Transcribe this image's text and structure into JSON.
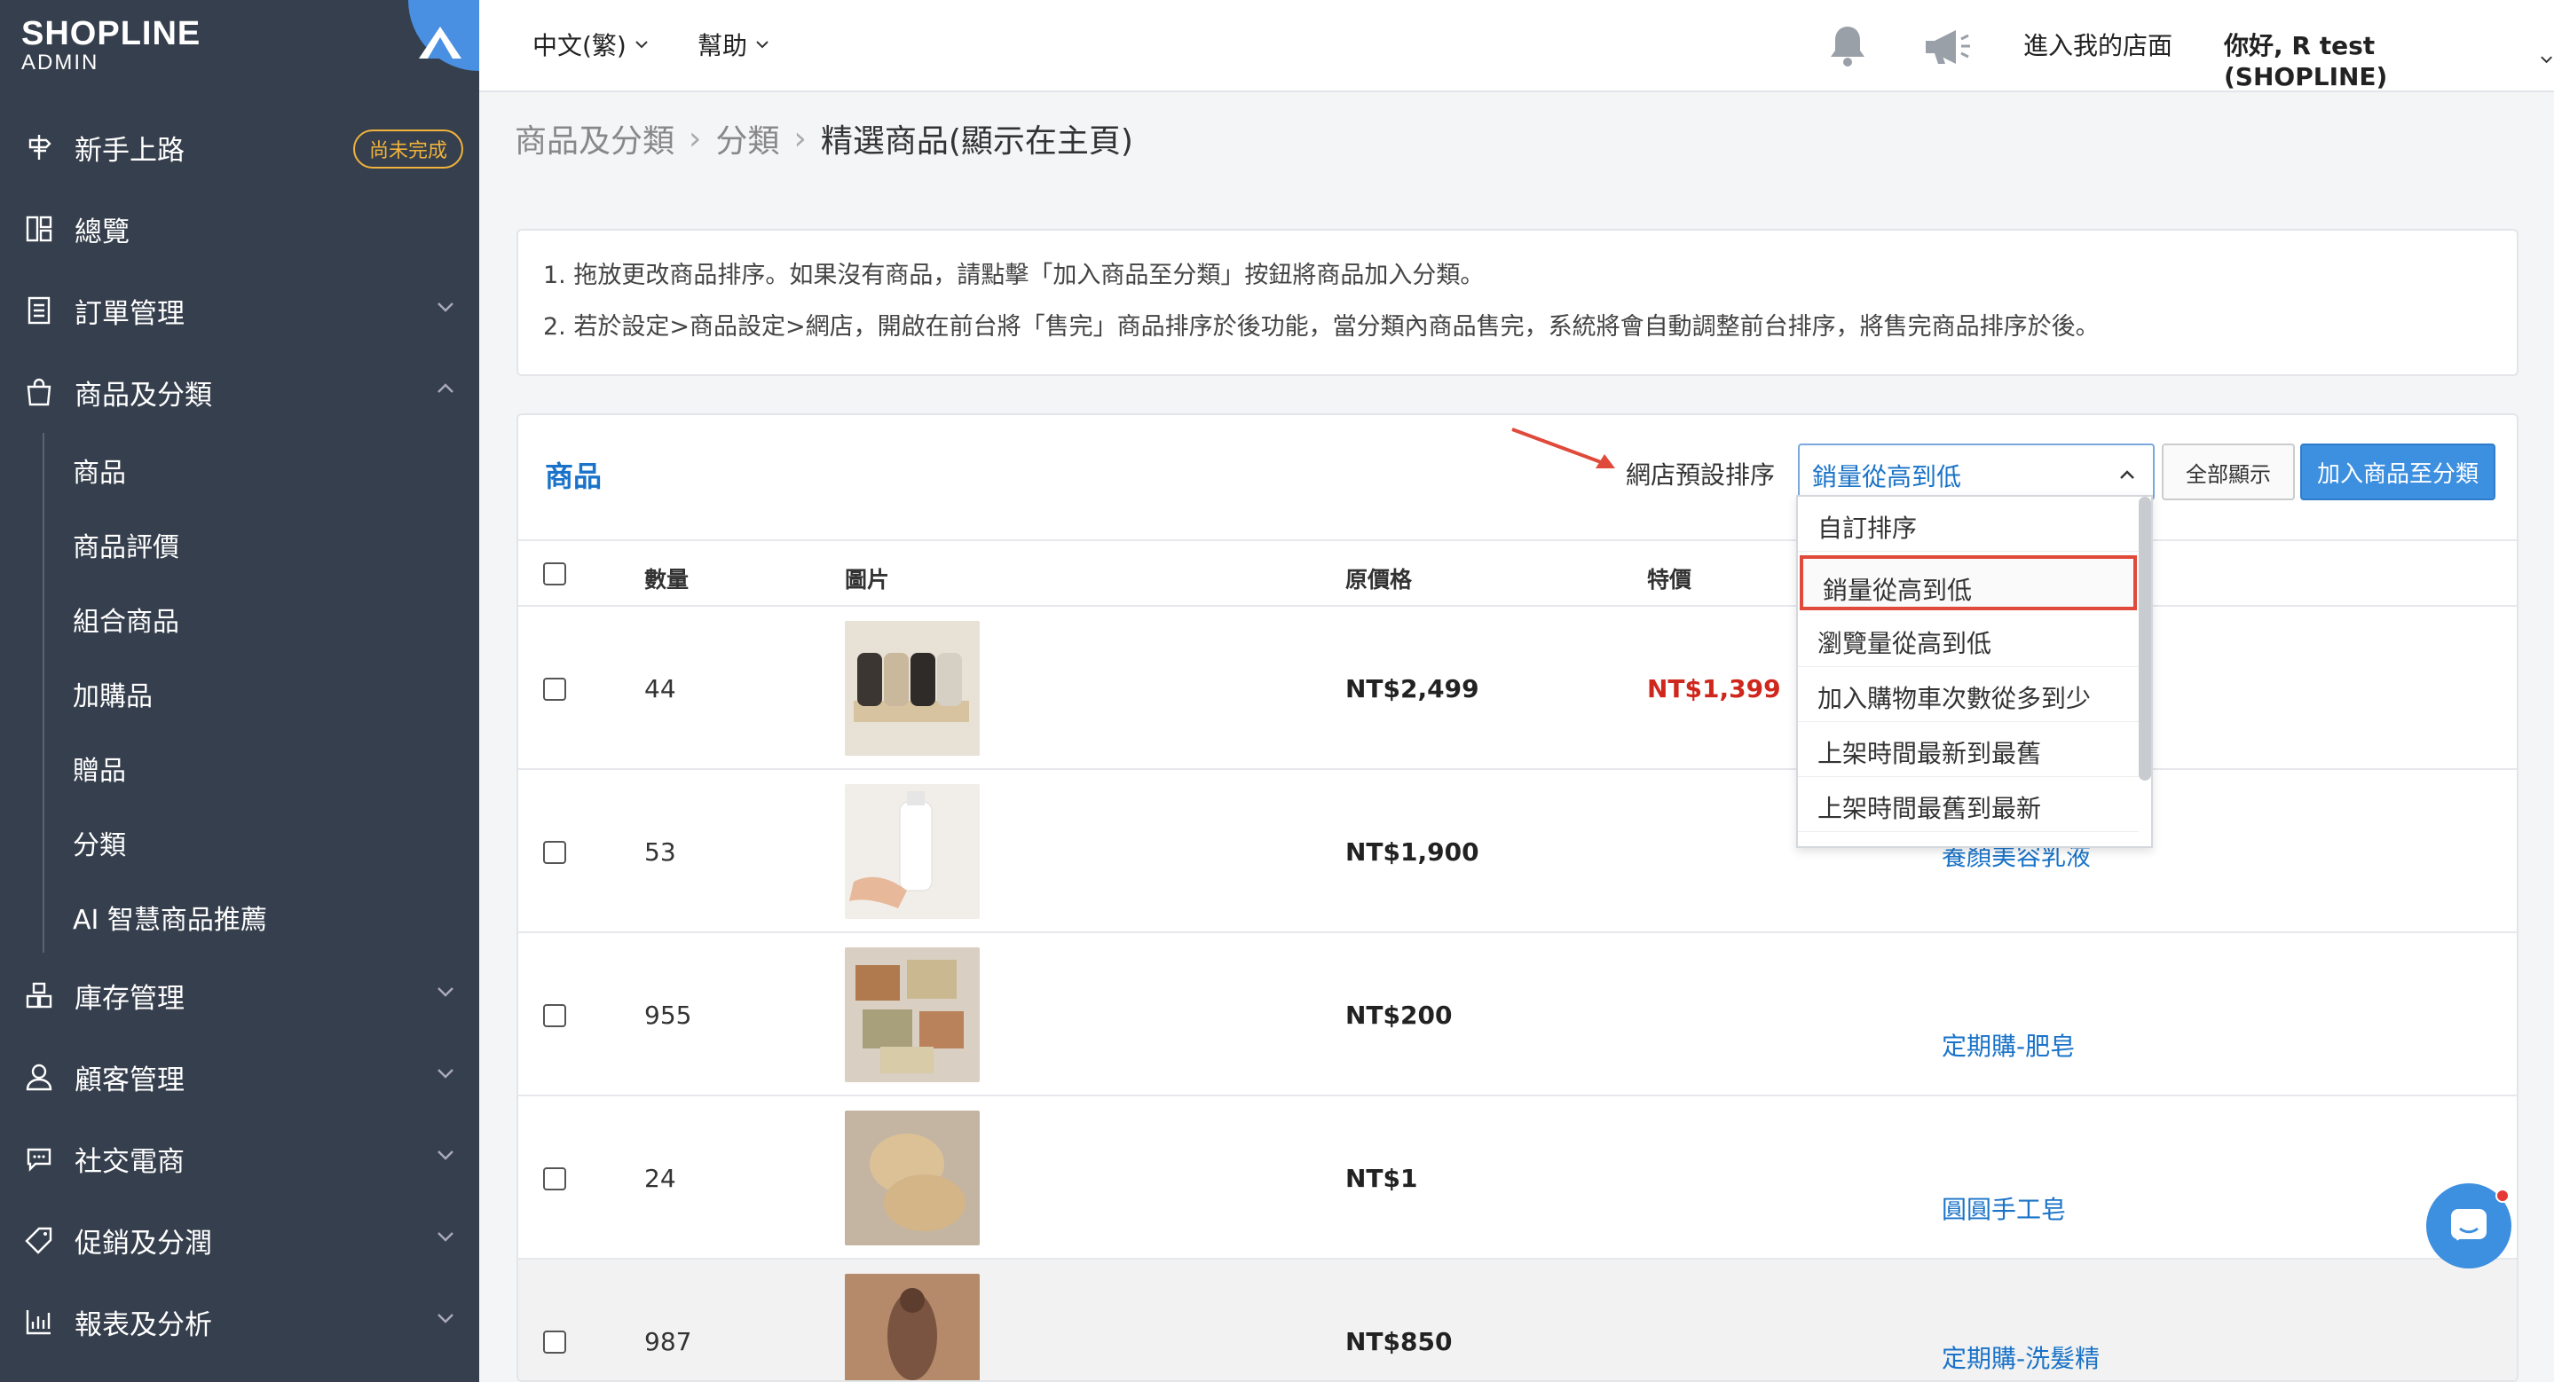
{
  "brand": {
    "name": "SHOPLINE",
    "sub": "ADMIN"
  },
  "sidebar": {
    "items": [
      {
        "label": "新手上路",
        "icon": "signpost-icon",
        "badge": "尚未完成"
      },
      {
        "label": "總覽",
        "icon": "dashboard-icon"
      },
      {
        "label": "訂單管理",
        "icon": "order-list-icon"
      },
      {
        "label": "商品及分類",
        "icon": "shopping-bag-icon"
      },
      {
        "label": "庫存管理",
        "icon": "inventory-icon"
      },
      {
        "label": "顧客管理",
        "icon": "user-icon"
      },
      {
        "label": "社交電商",
        "icon": "chat-bubble-icon"
      },
      {
        "label": "促銷及分潤",
        "icon": "tag-icon"
      },
      {
        "label": "報表及分析",
        "icon": "chart-icon"
      }
    ],
    "submenu": [
      "商品",
      "商品評價",
      "組合商品",
      "加購品",
      "贈品",
      "分類",
      "AI 智慧商品推薦"
    ]
  },
  "topbar": {
    "language": "中文(繁)",
    "help": "幫助",
    "enter_store": "進入我的店面",
    "greeting": "你好, R test (SHOPLINE)"
  },
  "breadcrumb": [
    "商品及分類",
    "分類",
    "精選商品(顯示在主頁)"
  ],
  "info": {
    "line1": "1. 拖放更改商品排序。如果沒有商品，請點擊「加入商品至分類」按鈕將商品加入分類。",
    "line2": "2. 若於設定>商品設定>網店，開啟在前台將「售完」商品排序於後功能，當分類內商品售完，系統將會自動調整前台排序，將售完商品排序於後。"
  },
  "panel": {
    "title": "商品",
    "sort_label": "網店預設排序",
    "sort_value": "銷量從高到低",
    "show_all": "全部顯示",
    "add_button": "加入商品至分類"
  },
  "table": {
    "headers": {
      "qty": "數量",
      "image": "圖片",
      "price": "原價格",
      "sale": "特價"
    },
    "rows": [
      {
        "qty": "44",
        "price": "NT$2,499",
        "sale": "NT$1,399",
        "name": ""
      },
      {
        "qty": "53",
        "price": "NT$1,900",
        "sale": "",
        "name": "養顏美容乳液"
      },
      {
        "qty": "955",
        "price": "NT$200",
        "sale": "",
        "name": "定期購-肥皂"
      },
      {
        "qty": "24",
        "price": "NT$1",
        "sale": "",
        "name": "圓圓手工皂"
      },
      {
        "qty": "987",
        "price": "NT$850",
        "sale": "",
        "name": "定期購-洗髮精"
      }
    ]
  },
  "dropdown": {
    "options": [
      "自訂排序",
      "銷量從高到低",
      "瀏覽量從高到低",
      "加入購物車次數從多到少",
      "上架時間最新到最舊",
      "上架時間最舊到最新"
    ],
    "selected_index": 1
  },
  "colors": {
    "sidebar": "#363f4d",
    "accent": "#1a73c8",
    "sale": "#d0271d",
    "highlight": "#e04a3a",
    "badge": "#f0b33c"
  }
}
